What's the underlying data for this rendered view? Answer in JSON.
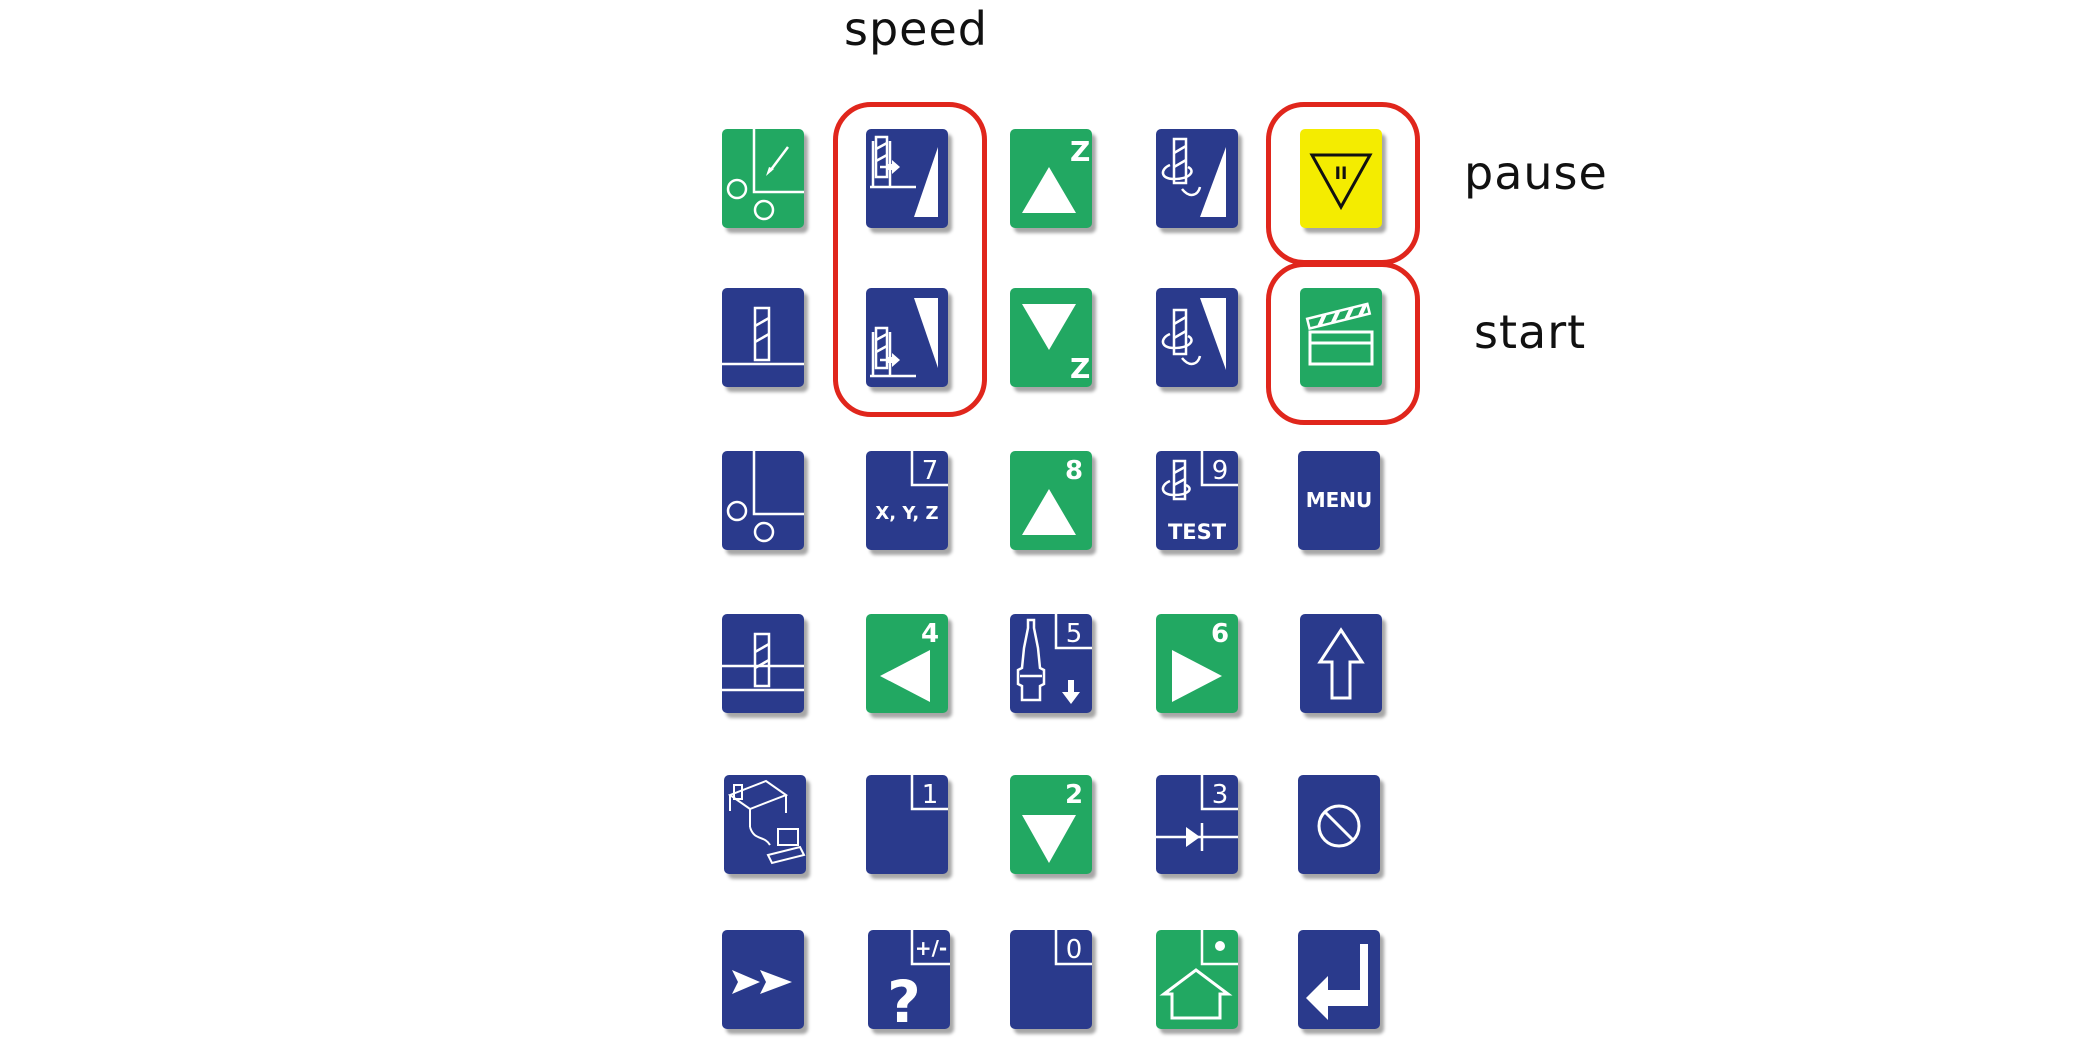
{
  "labels": {
    "speed": "speed",
    "pause": "pause",
    "start": "start"
  },
  "colors": {
    "key_blue": "#2a3a8c",
    "key_green": "#22a862",
    "key_yellow": "#f4ec00",
    "highlight": "#e0261c"
  },
  "keys": {
    "k7": "7",
    "xyz": "X, Y, Z",
    "k8": "8",
    "k9": "9",
    "test": "TEST",
    "menu": "MENU",
    "k4": "4",
    "k5": "5",
    "k6": "6",
    "k1": "1",
    "k2": "2",
    "k3": "3",
    "plusminus": "+/-",
    "question": "?",
    "k0": "0",
    "zup": "Z",
    "zdown": "Z",
    "pause_symbol": "II"
  }
}
